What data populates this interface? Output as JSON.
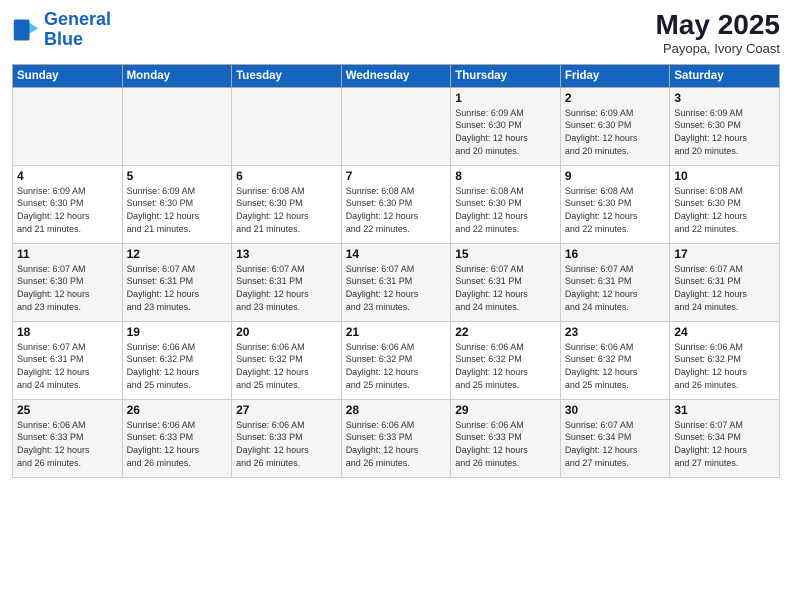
{
  "header": {
    "logo_line1": "General",
    "logo_line2": "Blue",
    "month_year": "May 2025",
    "location": "Payopa, Ivory Coast"
  },
  "weekdays": [
    "Sunday",
    "Monday",
    "Tuesday",
    "Wednesday",
    "Thursday",
    "Friday",
    "Saturday"
  ],
  "weeks": [
    [
      {
        "day": "",
        "detail": ""
      },
      {
        "day": "",
        "detail": ""
      },
      {
        "day": "",
        "detail": ""
      },
      {
        "day": "",
        "detail": ""
      },
      {
        "day": "1",
        "detail": "Sunrise: 6:09 AM\nSunset: 6:30 PM\nDaylight: 12 hours\nand 20 minutes."
      },
      {
        "day": "2",
        "detail": "Sunrise: 6:09 AM\nSunset: 6:30 PM\nDaylight: 12 hours\nand 20 minutes."
      },
      {
        "day": "3",
        "detail": "Sunrise: 6:09 AM\nSunset: 6:30 PM\nDaylight: 12 hours\nand 20 minutes."
      }
    ],
    [
      {
        "day": "4",
        "detail": "Sunrise: 6:09 AM\nSunset: 6:30 PM\nDaylight: 12 hours\nand 21 minutes."
      },
      {
        "day": "5",
        "detail": "Sunrise: 6:09 AM\nSunset: 6:30 PM\nDaylight: 12 hours\nand 21 minutes."
      },
      {
        "day": "6",
        "detail": "Sunrise: 6:08 AM\nSunset: 6:30 PM\nDaylight: 12 hours\nand 21 minutes."
      },
      {
        "day": "7",
        "detail": "Sunrise: 6:08 AM\nSunset: 6:30 PM\nDaylight: 12 hours\nand 22 minutes."
      },
      {
        "day": "8",
        "detail": "Sunrise: 6:08 AM\nSunset: 6:30 PM\nDaylight: 12 hours\nand 22 minutes."
      },
      {
        "day": "9",
        "detail": "Sunrise: 6:08 AM\nSunset: 6:30 PM\nDaylight: 12 hours\nand 22 minutes."
      },
      {
        "day": "10",
        "detail": "Sunrise: 6:08 AM\nSunset: 6:30 PM\nDaylight: 12 hours\nand 22 minutes."
      }
    ],
    [
      {
        "day": "11",
        "detail": "Sunrise: 6:07 AM\nSunset: 6:30 PM\nDaylight: 12 hours\nand 23 minutes."
      },
      {
        "day": "12",
        "detail": "Sunrise: 6:07 AM\nSunset: 6:31 PM\nDaylight: 12 hours\nand 23 minutes."
      },
      {
        "day": "13",
        "detail": "Sunrise: 6:07 AM\nSunset: 6:31 PM\nDaylight: 12 hours\nand 23 minutes."
      },
      {
        "day": "14",
        "detail": "Sunrise: 6:07 AM\nSunset: 6:31 PM\nDaylight: 12 hours\nand 23 minutes."
      },
      {
        "day": "15",
        "detail": "Sunrise: 6:07 AM\nSunset: 6:31 PM\nDaylight: 12 hours\nand 24 minutes."
      },
      {
        "day": "16",
        "detail": "Sunrise: 6:07 AM\nSunset: 6:31 PM\nDaylight: 12 hours\nand 24 minutes."
      },
      {
        "day": "17",
        "detail": "Sunrise: 6:07 AM\nSunset: 6:31 PM\nDaylight: 12 hours\nand 24 minutes."
      }
    ],
    [
      {
        "day": "18",
        "detail": "Sunrise: 6:07 AM\nSunset: 6:31 PM\nDaylight: 12 hours\nand 24 minutes."
      },
      {
        "day": "19",
        "detail": "Sunrise: 6:06 AM\nSunset: 6:32 PM\nDaylight: 12 hours\nand 25 minutes."
      },
      {
        "day": "20",
        "detail": "Sunrise: 6:06 AM\nSunset: 6:32 PM\nDaylight: 12 hours\nand 25 minutes."
      },
      {
        "day": "21",
        "detail": "Sunrise: 6:06 AM\nSunset: 6:32 PM\nDaylight: 12 hours\nand 25 minutes."
      },
      {
        "day": "22",
        "detail": "Sunrise: 6:06 AM\nSunset: 6:32 PM\nDaylight: 12 hours\nand 25 minutes."
      },
      {
        "day": "23",
        "detail": "Sunrise: 6:06 AM\nSunset: 6:32 PM\nDaylight: 12 hours\nand 25 minutes."
      },
      {
        "day": "24",
        "detail": "Sunrise: 6:06 AM\nSunset: 6:32 PM\nDaylight: 12 hours\nand 26 minutes."
      }
    ],
    [
      {
        "day": "25",
        "detail": "Sunrise: 6:06 AM\nSunset: 6:33 PM\nDaylight: 12 hours\nand 26 minutes."
      },
      {
        "day": "26",
        "detail": "Sunrise: 6:06 AM\nSunset: 6:33 PM\nDaylight: 12 hours\nand 26 minutes."
      },
      {
        "day": "27",
        "detail": "Sunrise: 6:06 AM\nSunset: 6:33 PM\nDaylight: 12 hours\nand 26 minutes."
      },
      {
        "day": "28",
        "detail": "Sunrise: 6:06 AM\nSunset: 6:33 PM\nDaylight: 12 hours\nand 26 minutes."
      },
      {
        "day": "29",
        "detail": "Sunrise: 6:06 AM\nSunset: 6:33 PM\nDaylight: 12 hours\nand 26 minutes."
      },
      {
        "day": "30",
        "detail": "Sunrise: 6:07 AM\nSunset: 6:34 PM\nDaylight: 12 hours\nand 27 minutes."
      },
      {
        "day": "31",
        "detail": "Sunrise: 6:07 AM\nSunset: 6:34 PM\nDaylight: 12 hours\nand 27 minutes."
      }
    ]
  ]
}
